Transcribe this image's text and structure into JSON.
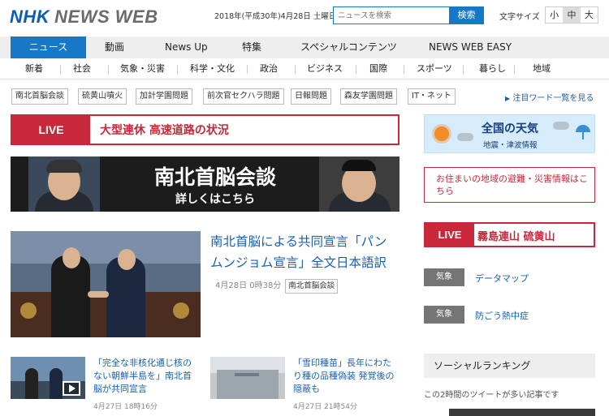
{
  "header": {
    "logo_nhk": "NHK",
    "logo_newsweb": "NEWS WEB",
    "date": "2018年(平成30年)4月28日 土曜日",
    "search_placeholder": "ニュースを検索",
    "search_button": "検索",
    "font_size_label": "文字サイズ",
    "font_sizes": [
      "小",
      "中",
      "大"
    ],
    "font_size_selected": "中"
  },
  "nav": [
    "ニュース",
    "動画",
    "News Up",
    "特集",
    "スペシャルコンテンツ",
    "NEWS WEB EASY"
  ],
  "subnav": [
    "新着",
    "社会",
    "気象・災害",
    "科学・文化",
    "政治",
    "ビジネス",
    "国際",
    "スポーツ",
    "暮らし",
    "地域"
  ],
  "tags": [
    "南北首脳会談",
    "硫黄山噴火",
    "加計学園問題",
    "前次官セクハラ問題",
    "日報問題",
    "森友学園問題",
    "IT・ネット"
  ],
  "tags_more": "注目ワード一覧を見る",
  "live_main": {
    "label": "LIVE",
    "text": "大型連休 高速道路の状況"
  },
  "banner": {
    "title": "南北首脳会談",
    "subtitle": "詳しくはこちら"
  },
  "main_article": {
    "headline": "南北首脳による共同宣言「パンムンジョム宣言」全文日本語訳",
    "date": "4月28日 0時38分",
    "tag": "南北首脳会談"
  },
  "small_articles": [
    {
      "headline": "「完全な非核化通じ核のない朝鮮半島を」南北首脳が共同宣言",
      "date": "4月27日 18時16分"
    },
    {
      "headline": "「雪印種苗」長年にわたり種の品種偽装 発覚後の隠蔽も",
      "date": "4月27日 21時54分"
    }
  ],
  "sidebar": {
    "weather_title": "全国の天気",
    "weather_sub": "地震・津波情報",
    "evac_text": "お住まいの地域の避難・災害情報はこちら",
    "live": {
      "label": "LIVE",
      "text": "霧島連山 硫黄山"
    },
    "links": [
      {
        "tag": "気象",
        "text": "データマップ"
      },
      {
        "tag": "気象",
        "text": "防ごう熱中症"
      }
    ],
    "ranking_title": "ソーシャルランキング",
    "ranking_sub": "この2時間のツイートが多い記事です"
  },
  "colors": {
    "accent": "#1878c8",
    "live_red": "#c8283a",
    "link": "#1a60b0"
  }
}
